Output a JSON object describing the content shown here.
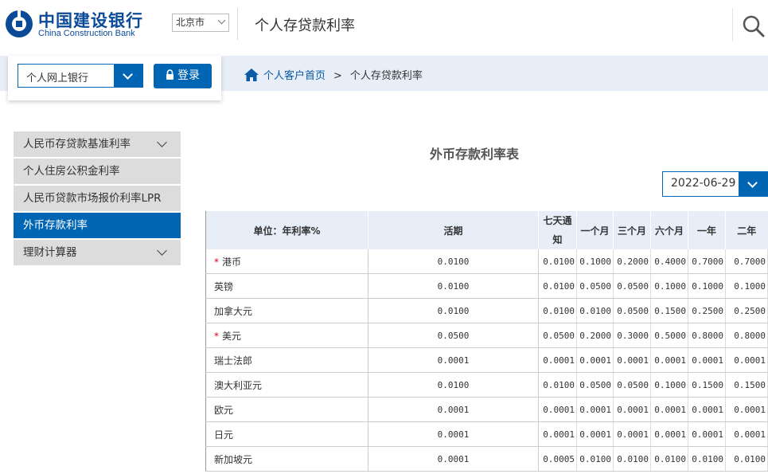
{
  "header": {
    "bank_name_cn": "中国建设银行",
    "bank_name_en": "China Construction Bank",
    "city": "北京市",
    "page_title": "个人存贷款利率",
    "brand_color": "#0066b3"
  },
  "login": {
    "bank_select": "个人网上银行",
    "login_button": "登录"
  },
  "breadcrumb": {
    "home": "个人客户首页",
    "separator": ">",
    "current": "个人存贷款利率"
  },
  "sidebar": {
    "items": [
      {
        "label": "人民币存贷款基准利率",
        "expandable": true,
        "active": false
      },
      {
        "label": "个人住房公积金利率",
        "expandable": false,
        "active": false
      },
      {
        "label": "人民币贷款市场报价利率LPR",
        "expandable": false,
        "active": false
      },
      {
        "label": "外币存款利率",
        "expandable": false,
        "active": true
      },
      {
        "label": "理财计算器",
        "expandable": true,
        "active": false
      }
    ]
  },
  "main": {
    "table_title": "外币存款利率表",
    "date": "2022-06-29",
    "columns": [
      "单位：年利率%",
      "活期",
      "七天通知",
      "一个月",
      "三个月",
      "六个月",
      "一年",
      "二年"
    ],
    "rows": [
      {
        "name": "港币",
        "star": true,
        "values": [
          "0.0100",
          "0.0100",
          "0.1000",
          "0.2000",
          "0.4000",
          "0.7000",
          "0.7000"
        ]
      },
      {
        "name": "英镑",
        "star": false,
        "values": [
          "0.0100",
          "0.0100",
          "0.0500",
          "0.0500",
          "0.1000",
          "0.1000",
          "0.1000"
        ]
      },
      {
        "name": "加拿大元",
        "star": false,
        "values": [
          "0.0100",
          "0.0100",
          "0.0100",
          "0.0500",
          "0.1500",
          "0.2500",
          "0.2500"
        ]
      },
      {
        "name": "美元",
        "star": true,
        "values": [
          "0.0500",
          "0.0500",
          "0.2000",
          "0.3000",
          "0.5000",
          "0.8000",
          "0.8000"
        ]
      },
      {
        "name": "瑞士法郎",
        "star": false,
        "values": [
          "0.0001",
          "0.0001",
          "0.0001",
          "0.0001",
          "0.0001",
          "0.0001",
          "0.0001"
        ]
      },
      {
        "name": "澳大利亚元",
        "star": false,
        "values": [
          "0.0100",
          "0.0100",
          "0.0500",
          "0.0500",
          "0.1000",
          "0.1500",
          "0.1500"
        ]
      },
      {
        "name": "欧元",
        "star": false,
        "values": [
          "0.0001",
          "0.0001",
          "0.0001",
          "0.0001",
          "0.0001",
          "0.0001",
          "0.0001"
        ]
      },
      {
        "name": "日元",
        "star": false,
        "values": [
          "0.0001",
          "0.0001",
          "0.0001",
          "0.0001",
          "0.0001",
          "0.0001",
          "0.0001"
        ]
      },
      {
        "name": "新加坡元",
        "star": false,
        "values": [
          "0.0001",
          "0.0005",
          "0.0100",
          "0.0100",
          "0.0100",
          "0.0100",
          "0.0100"
        ]
      }
    ]
  }
}
